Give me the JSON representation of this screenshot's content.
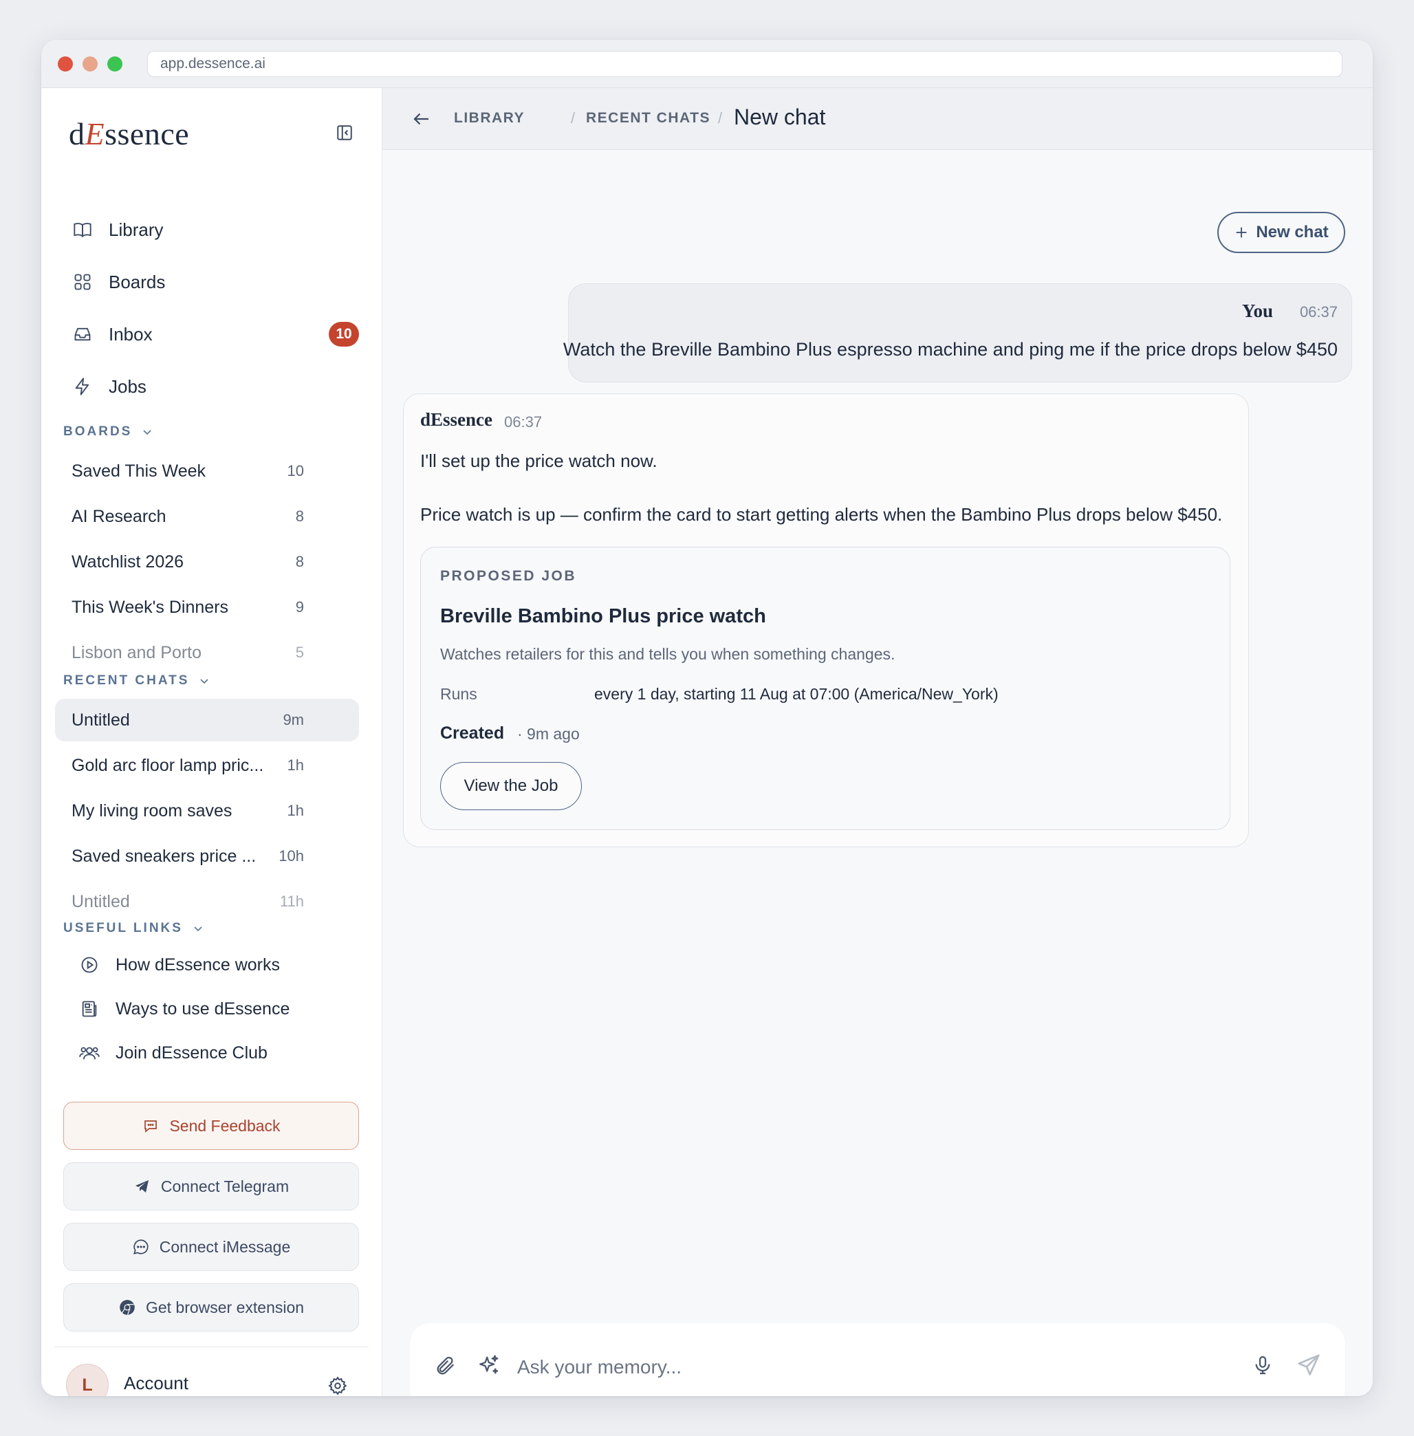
{
  "browser": {
    "url": "app.dessence.ai"
  },
  "sidebar": {
    "logo": {
      "d": "d",
      "e": "E",
      "rest": "ssence"
    },
    "nav": [
      {
        "label": "Library",
        "icon": "book-icon"
      },
      {
        "label": "Boards",
        "icon": "grid-icon"
      },
      {
        "label": "Inbox",
        "icon": "inbox-icon",
        "badge": "10"
      },
      {
        "label": "Jobs",
        "icon": "bolt-icon"
      }
    ],
    "boards": {
      "heading": "BOARDS",
      "items": [
        {
          "title": "Saved This Week",
          "count": "10"
        },
        {
          "title": "AI Research",
          "count": "8"
        },
        {
          "title": "Watchlist 2026",
          "count": "8"
        },
        {
          "title": "This Week's Dinners",
          "count": "9"
        },
        {
          "title": "Lisbon and Porto",
          "count": "5"
        }
      ]
    },
    "recent_chats": {
      "heading": "RECENT CHATS",
      "items": [
        {
          "title": "Untitled",
          "age": "9m"
        },
        {
          "title": "Gold arc floor lamp pric...",
          "age": "1h"
        },
        {
          "title": "My living room saves",
          "age": "1h"
        },
        {
          "title": "Saved sneakers price ...",
          "age": "10h"
        },
        {
          "title": "Untitled",
          "age": "11h"
        }
      ]
    },
    "useful_links": {
      "heading": "USEFUL LINKS",
      "items": [
        {
          "label": "How dEssence works",
          "icon": "play-circle-icon"
        },
        {
          "label": "Ways to use dEssence",
          "icon": "newspaper-icon"
        },
        {
          "label": "Join dEssence Club",
          "icon": "users-icon"
        }
      ]
    },
    "buttons": {
      "feedback": "Send Feedback",
      "telegram": "Connect Telegram",
      "imessage": "Connect iMessage",
      "extension": "Get browser extension"
    },
    "account": {
      "initial": "L",
      "label": "Account"
    }
  },
  "header": {
    "breadcrumb": [
      "LIBRARY",
      "RECENT CHATS"
    ],
    "separator": "/",
    "title": "New chat"
  },
  "chat": {
    "new_chat_label": "New chat",
    "messages": {
      "user": {
        "author": "You",
        "time": "06:37",
        "text": "Watch the Breville Bambino Plus espresso machine and ping me if the price drops below $450"
      },
      "bot": {
        "author": "dEssence",
        "time": "06:37",
        "p1": "I'll set up the price watch now.",
        "p2": "Price watch is up — confirm the card to start getting alerts when the Bambino Plus drops below $450."
      }
    },
    "job_card": {
      "kicker": "PROPOSED JOB",
      "title": "Breville Bambino Plus price watch",
      "description": "Watches retailers for this and tells you when something changes.",
      "runs_label": "Runs",
      "runs_value": "every 1 day, starting 11 Aug at 07:00 (America/New_York)",
      "created_label": "Created",
      "created_value": "· 9m ago",
      "button": "View the Job"
    }
  },
  "composer": {
    "placeholder": "Ask your memory..."
  },
  "colors": {
    "accent": "#c5442e",
    "primary": "#4f6585",
    "text": "#1f2a3c"
  }
}
